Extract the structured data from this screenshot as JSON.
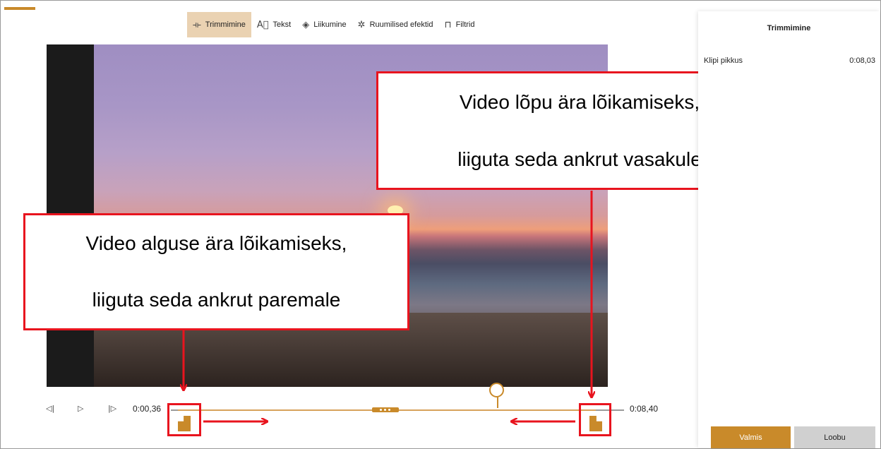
{
  "toolbar": {
    "items": [
      {
        "label": "Trimmimine",
        "icon": "trim-icon",
        "active": true
      },
      {
        "label": "Tekst",
        "icon": "text-icon",
        "active": false
      },
      {
        "label": "Liikumine",
        "icon": "motion-icon",
        "active": false
      },
      {
        "label": "Ruumilised efektid",
        "icon": "3d-effects-icon",
        "active": false
      },
      {
        "label": "Filtrid",
        "icon": "filters-icon",
        "active": false
      }
    ]
  },
  "timeline": {
    "start_time": "0:00,36",
    "end_time": "0:08,40",
    "controls": [
      "previous-frame-icon",
      "play-icon",
      "next-frame-icon"
    ]
  },
  "panel": {
    "title": "Trimmimine",
    "clip_length_label": "Klipi pikkus",
    "clip_length_value": "0:08,03",
    "done_button": "Valmis",
    "cancel_button": "Loobu"
  },
  "annotations": {
    "right": {
      "line1": "Video lõpu ära lõikamiseks,",
      "line2": "liiguta seda ankrut vasakule"
    },
    "left": {
      "line1": "Video alguse ära lõikamiseks,",
      "line2": "liiguta seda ankrut paremale"
    }
  },
  "colors": {
    "accent": "#c98a2a",
    "annotation_red": "#e8141e"
  }
}
